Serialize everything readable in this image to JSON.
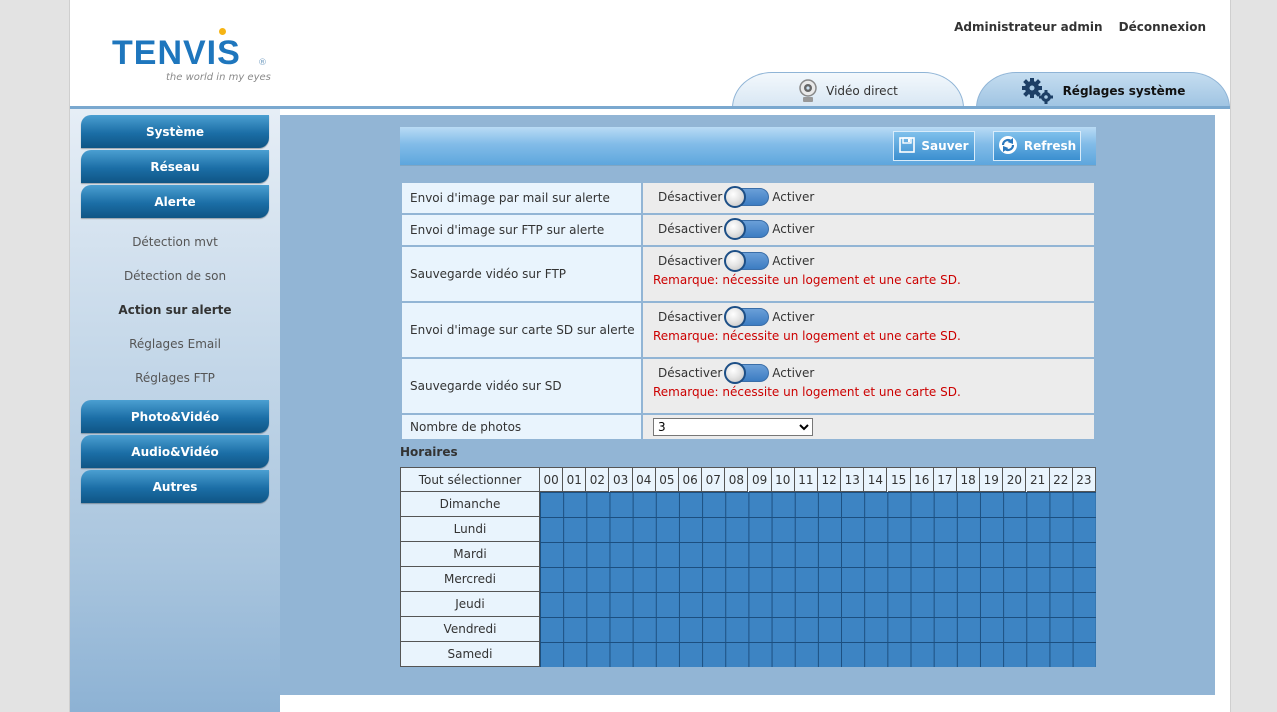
{
  "header": {
    "logo_text": "TENVIS",
    "logo_tagline": "the world in my eyes",
    "user_label": "Administrateur admin",
    "logout_label": "Déconnexion"
  },
  "tabs": [
    {
      "label": "Vidéo direct",
      "icon": "camera-icon",
      "active": false
    },
    {
      "label": "Réglages système",
      "icon": "gears-icon",
      "active": true
    }
  ],
  "sidebar": {
    "buttons_top": [
      "Système",
      "Réseau",
      "Alerte"
    ],
    "sub_items": [
      "Détection mvt",
      "Détection de son",
      "Action sur alerte",
      "Réglages Email",
      "Réglages FTP"
    ],
    "active_sub": "Action sur alerte",
    "buttons_bottom": [
      "Photo&Vidéo",
      "Audio&Vidéo",
      "Autres"
    ]
  },
  "toolbar": {
    "save_label": "Sauver",
    "refresh_label": "Refresh"
  },
  "settings": {
    "off_label": "Désactiver",
    "on_label": "Activer",
    "note": "Remarque: nécessite un logement et une carte SD.",
    "rows": [
      {
        "label": "Envoi d'image par mail sur alerte",
        "state": "Désactiver"
      },
      {
        "label": "Envoi d'image sur FTP sur alerte",
        "state": "Désactiver"
      },
      {
        "label": "Sauvegarde vidéo sur FTP",
        "state": "Désactiver"
      },
      {
        "label": "Envoi d'image sur carte SD sur alerte",
        "state": "Désactiver"
      },
      {
        "label": "Sauvegarde vidéo sur SD",
        "state": "Désactiver"
      }
    ],
    "photos_label": "Nombre de photos",
    "photos_value": "3"
  },
  "schedule": {
    "title": "Horaires",
    "select_all_label": "Tout sélectionner",
    "hours": [
      "00",
      "01",
      "02",
      "03",
      "04",
      "05",
      "06",
      "07",
      "08",
      "09",
      "10",
      "11",
      "12",
      "13",
      "14",
      "15",
      "16",
      "17",
      "18",
      "19",
      "20",
      "21",
      "22",
      "23"
    ],
    "days": [
      "Dimanche",
      "Lundi",
      "Mardi",
      "Mercredi",
      "Jeudi",
      "Vendredi",
      "Samedi"
    ],
    "all_selected": true
  },
  "colors": {
    "accent_blue": "#1e76bd",
    "selected_cell": "#3d84c3",
    "note_red": "#cc0000"
  }
}
